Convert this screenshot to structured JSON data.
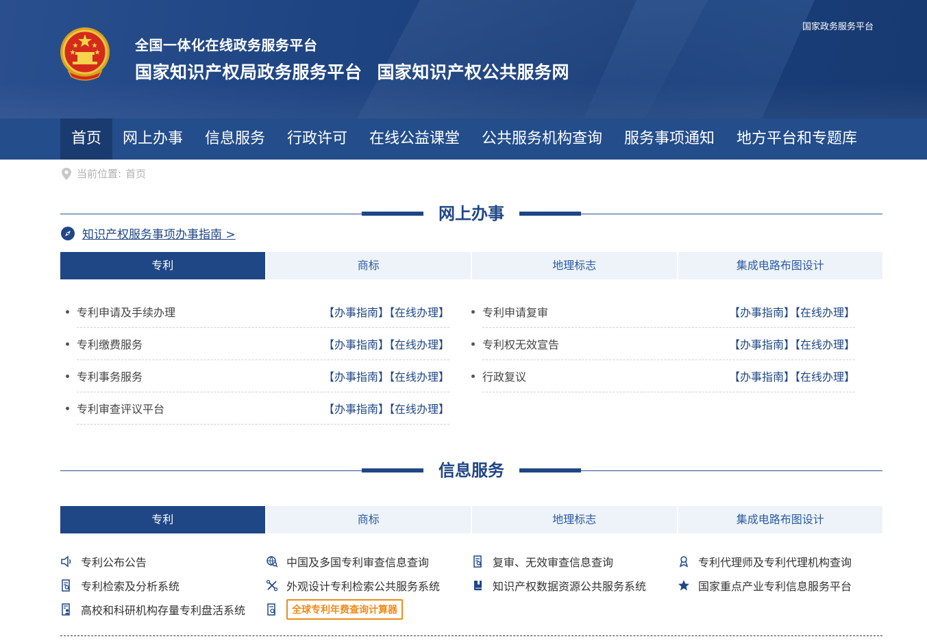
{
  "header": {
    "top_right_link": "国家政务服务平台",
    "title_small": "全国一体化在线政务服务平台",
    "title_big_1": "国家知识产权局政务服务平台",
    "title_big_2": "国家知识产权公共服务网"
  },
  "nav": [
    {
      "label": "首页",
      "active": true
    },
    {
      "label": "网上办事"
    },
    {
      "label": "信息服务"
    },
    {
      "label": "行政许可"
    },
    {
      "label": "在线公益课堂"
    },
    {
      "label": "公共服务机构查询"
    },
    {
      "label": "服务事项通知"
    },
    {
      "label": "地方平台和专题库"
    }
  ],
  "breadcrumb": {
    "label": "当前位置:",
    "current": "首页"
  },
  "online_section": {
    "title": "网上办事",
    "guide_link": "知识产权服务事项办事指南 >",
    "tabs": [
      "专利",
      "商标",
      "地理标志",
      "集成电路布图设计"
    ],
    "link_guide": "【办事指南】",
    "link_online": "【在线办理】",
    "left_items": [
      "专利申请及手续办理",
      "专利缴费服务",
      "专利事务服务",
      "专利审查评议平台"
    ],
    "right_items": [
      "专利申请复审",
      "专利权无效宣告",
      "行政复议"
    ]
  },
  "info_section": {
    "title": "信息服务",
    "tabs": [
      "专利",
      "商标",
      "地理标志",
      "集成电路布图设计"
    ],
    "items": [
      {
        "label": "专利公布公告",
        "icon": "speaker-icon"
      },
      {
        "label": "中国及多国专利审查信息查询",
        "icon": "globe-search-icon"
      },
      {
        "label": "复审、无效审查信息查询",
        "icon": "document-search-icon"
      },
      {
        "label": "专利代理师及专利代理机构查询",
        "icon": "person-badge-icon"
      },
      {
        "label": "专利检索及分析系统",
        "icon": "document-search-icon"
      },
      {
        "label": "外观设计专利检索公共服务系统",
        "icon": "tools-icon"
      },
      {
        "label": "知识产权数据资源公共服务系统",
        "icon": "book-icon"
      },
      {
        "label": "国家重点产业专利信息服务平台",
        "icon": "star-icon"
      },
      {
        "label": "高校和科研机构存量专利盘活系统",
        "icon": "document-person-icon"
      },
      {
        "label": "全球专利年费查询计算器",
        "icon": "calculator-icon"
      }
    ]
  },
  "colors": {
    "primary": "#1f4685",
    "nav": "#234d8b",
    "accent_orange": "#f08a1a"
  }
}
